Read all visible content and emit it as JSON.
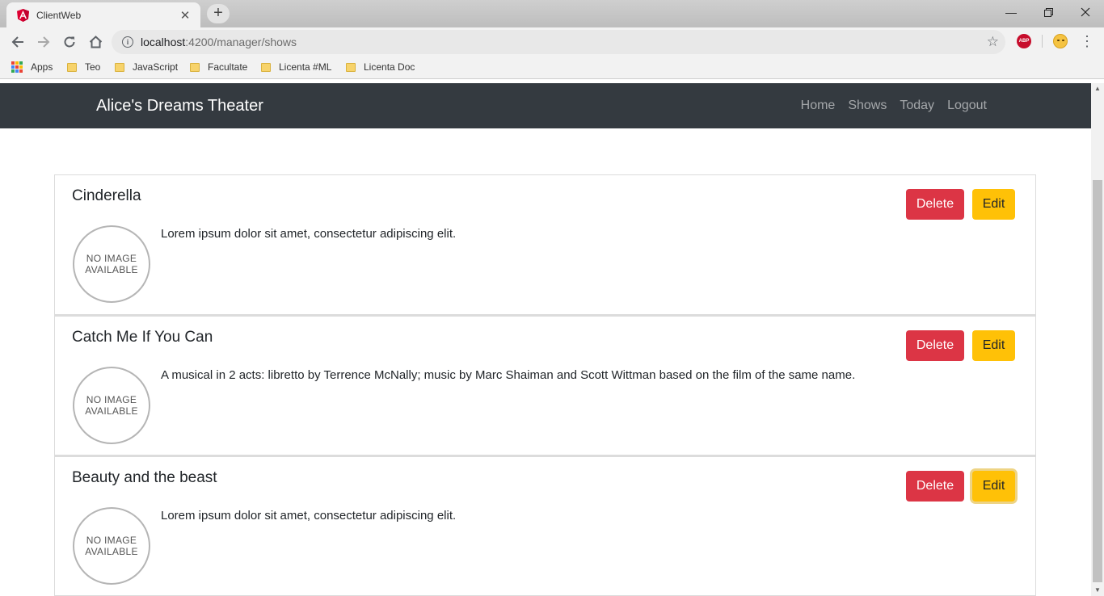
{
  "browser": {
    "tab_title": "ClientWeb",
    "url_host": "localhost",
    "url_path": ":4200/manager/shows",
    "abp_label": "ABP",
    "bookmarks": [
      {
        "label": "Apps",
        "icon": "apps-grid-icon"
      },
      {
        "label": "Teo",
        "icon": "folder-icon"
      },
      {
        "label": "JavaScript",
        "icon": "folder-icon"
      },
      {
        "label": "Facultate",
        "icon": "folder-icon"
      },
      {
        "label": "Licenta #ML",
        "icon": "folder-icon"
      },
      {
        "label": "Licenta Doc",
        "icon": "folder-icon"
      }
    ]
  },
  "navbar": {
    "brand": "Alice's Dreams Theater",
    "links": [
      "Home",
      "Shows",
      "Today",
      "Logout"
    ],
    "bg_color": "#343a40"
  },
  "shows": [
    {
      "title": "Cinderella",
      "description": "Lorem ipsum dolor sit amet, consectetur adipiscing elit.",
      "image_line1": "NO IMAGE",
      "image_line2": "AVAILABLE",
      "delete_label": "Delete",
      "edit_label": "Edit"
    },
    {
      "title": "Catch Me If You Can",
      "description": "A musical in 2 acts: libretto by Terrence McNally; music by Marc Shaiman and Scott Wittman based on the film of the same name.",
      "image_line1": "NO IMAGE",
      "image_line2": "AVAILABLE",
      "delete_label": "Delete",
      "edit_label": "Edit"
    },
    {
      "title": "Beauty and the beast",
      "description": "Lorem ipsum dolor sit amet, consectetur adipiscing elit.",
      "image_line1": "NO IMAGE",
      "image_line2": "AVAILABLE",
      "delete_label": "Delete",
      "edit_label": "Edit"
    }
  ],
  "colors": {
    "delete": "#dc3545",
    "edit": "#ffc107"
  }
}
